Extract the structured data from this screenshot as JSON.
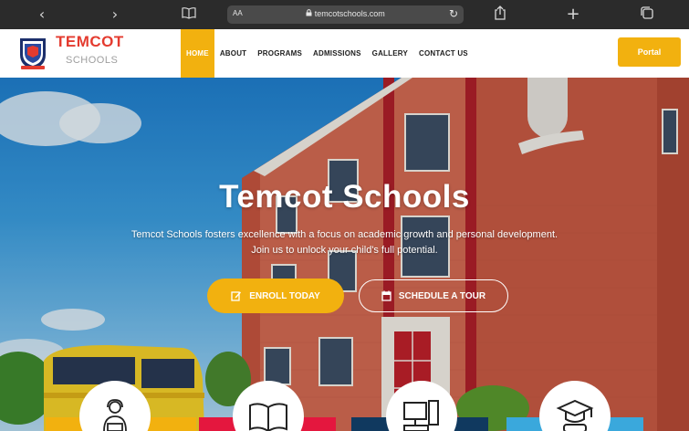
{
  "browser": {
    "url_prefix": "AA",
    "url": "temcotschools.com",
    "icons": [
      "back-icon",
      "forward-icon",
      "bookmarks-icon",
      "reload-icon",
      "share-icon",
      "new-tab-icon",
      "tabs-icon"
    ]
  },
  "header": {
    "brand_line1": "TEMCOT",
    "brand_line2": "SCHOOLS",
    "nav": [
      "HOME",
      "ABOUT",
      "PROGRAMS",
      "ADMISSIONS",
      "GALLERY",
      "CONTACT US"
    ],
    "active_nav": "HOME",
    "portal_label": "Portal"
  },
  "hero": {
    "title": "Temcot Schools",
    "subtitle_line1": "Temcot Schools fosters excellence with a focus on academic growth and personal development.",
    "subtitle_line2": "Join us to unlock your child's full potential.",
    "enroll_label": "ENROLL TODAY",
    "tour_label": "SCHEDULE A TOUR"
  },
  "features": [
    {
      "icon": "teacher-icon",
      "color": "#f2b10f"
    },
    {
      "icon": "book-icon",
      "color": "#e4173e"
    },
    {
      "icon": "computer-icon",
      "color": "#10395f"
    },
    {
      "icon": "graduate-icon",
      "color": "#3aa8dc"
    }
  ],
  "colors": {
    "accent": "#f2b10f",
    "brand_red": "#e43b2f"
  }
}
